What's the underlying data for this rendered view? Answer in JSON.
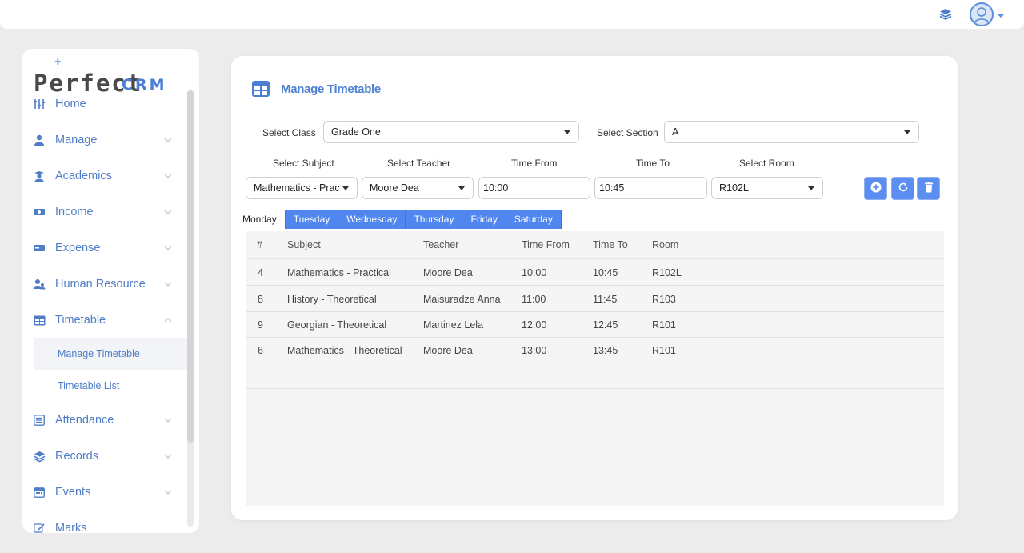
{
  "header": {
    "layers_icon": "layers-icon",
    "avatar_icon": "user-avatar-icon"
  },
  "logo": {
    "word": "erfect",
    "brand": "CRM",
    "prefix": "P"
  },
  "sidebar": {
    "items": [
      {
        "label": "Home",
        "icon": "sliders-icon"
      },
      {
        "label": "Manage",
        "icon": "user-icon"
      },
      {
        "label": "Academics",
        "icon": "graduate-icon"
      },
      {
        "label": "Income",
        "icon": "money-icon"
      },
      {
        "label": "Expense",
        "icon": "card-icon"
      },
      {
        "label": "Human Resource",
        "icon": "users-icon"
      },
      {
        "label": "Timetable",
        "icon": "table-icon"
      },
      {
        "label": "Attendance",
        "icon": "list-icon"
      },
      {
        "label": "Records",
        "icon": "layers-icon"
      },
      {
        "label": "Events",
        "icon": "calendar-icon"
      },
      {
        "label": "Marks",
        "icon": "pen-icon"
      }
    ],
    "sub_items": [
      {
        "label": "Manage Timetable"
      },
      {
        "label": "Timetable List"
      }
    ]
  },
  "main": {
    "title": "Manage Timetable",
    "filters": {
      "class_label": "Select Class",
      "class_value": "Grade One",
      "section_label": "Select Section",
      "section_value": "A"
    },
    "entry": {
      "subject_label": "Select Subject",
      "subject_value": "Mathematics - Prac",
      "teacher_label": "Select Teacher",
      "teacher_value": "Moore Dea",
      "from_label": "Time From",
      "from_value": "10:00",
      "to_label": "Time To",
      "to_value": "10:45",
      "room_label": "Select Room",
      "room_value": "R102L"
    },
    "tabs": [
      "Monday",
      "Tuesday",
      "Wednesday",
      "Thursday",
      "Friday",
      "Saturday"
    ],
    "table": {
      "headers": [
        "#",
        "Subject",
        "Teacher",
        "Time From",
        "Time To",
        "Room"
      ],
      "rows": [
        [
          "4",
          "Mathematics - Practical",
          "Moore Dea",
          "10:00",
          "10:45",
          "R102L"
        ],
        [
          "8",
          "History - Theoretical",
          "Maisuradze Anna",
          "11:00",
          "11:45",
          "R103"
        ],
        [
          "9",
          "Georgian - Theoretical",
          "Martinez Lela",
          "12:00",
          "12:45",
          "R101"
        ],
        [
          "6",
          "Mathematics - Theoretical",
          "Moore Dea",
          "13:00",
          "13:45",
          "R101"
        ]
      ]
    }
  },
  "colors": {
    "accent": "#4b7fd4",
    "tab": "#4f86f0"
  }
}
